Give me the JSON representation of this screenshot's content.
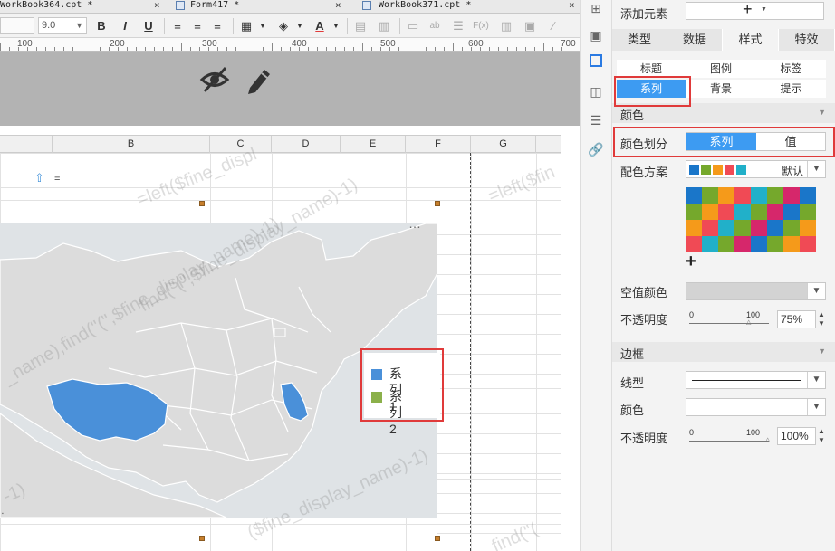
{
  "tabs": [
    {
      "label": "WorkBook364.cpt *"
    },
    {
      "label": "Form417 *"
    },
    {
      "label": "WorkBook371.cpt *"
    }
  ],
  "toolbar": {
    "font_size": "9.0",
    "bold": "B",
    "italic": "I",
    "underline": "U",
    "font_color_letter": "A"
  },
  "ruler": {
    "marks": [
      "100",
      "200",
      "300",
      "400",
      "500",
      "600",
      "700"
    ]
  },
  "sheet": {
    "columns": [
      "B",
      "C",
      "D",
      "E",
      "F",
      "G"
    ],
    "cell_formula": "=",
    "watermark_fragments": [
      "=left($fine_displ",
      "=left($fin",
      "_name),find(\"(\",$fine_display_name)-1)",
      "($fine_display_name)-1)",
      "-1)",
      "find(\"(\",$fine_display_name)-1)",
      "find(\"("
    ]
  },
  "legend": {
    "items": [
      {
        "label": "系列1",
        "color": "#4a90d9"
      },
      {
        "label": "系列2",
        "color": "#8bb04a"
      }
    ]
  },
  "map": {
    "colors": {
      "base": "#dcdcdc",
      "sea": "#dfe3e6",
      "highlight": "#4a90d9",
      "border": "#ffffff"
    }
  },
  "panel": {
    "add_element_label": "添加元素",
    "add_symbol": "+",
    "tabs": [
      {
        "label": "类型",
        "active": false
      },
      {
        "label": "数据",
        "active": false
      },
      {
        "label": "样式",
        "active": true
      },
      {
        "label": "特效",
        "active": false
      }
    ],
    "subtabs": [
      {
        "label": "标题",
        "active": false
      },
      {
        "label": "图例",
        "active": false
      },
      {
        "label": "标签",
        "active": false
      },
      {
        "label": "系列",
        "active": true
      },
      {
        "label": "背景",
        "active": false
      },
      {
        "label": "提示",
        "active": false
      }
    ],
    "color_section": "颜色",
    "color_division_label": "颜色划分",
    "color_division_options": [
      {
        "label": "系列",
        "active": true
      },
      {
        "label": "值",
        "active": false
      }
    ],
    "scheme_label": "配色方案",
    "scheme_value": "默认",
    "scheme_swatch_colors": [
      "#1a76c9",
      "#75a82c",
      "#f59a1a",
      "#f04a55",
      "#21b0c9"
    ],
    "palette_grid": [
      [
        "#1a76c9",
        "#75a82c",
        "#f59a1a",
        "#f04a55",
        "#21b0c9",
        "#75a82c",
        "#d6276b",
        "#1a76c9"
      ],
      [
        "#75a82c",
        "#f59a1a",
        "#f04a55",
        "#21b0c9",
        "#75a82c",
        "#d6276b",
        "#1a76c9",
        "#75a82c"
      ],
      [
        "#f59a1a",
        "#f04a55",
        "#21b0c9",
        "#75a82c",
        "#d6276b",
        "#1a76c9",
        "#75a82c",
        "#f59a1a"
      ],
      [
        "#f04a55",
        "#21b0c9",
        "#75a82c",
        "#d6276b",
        "#1a76c9",
        "#75a82c",
        "#f59a1a",
        "#f04a55"
      ]
    ],
    "add_color_symbol": "+",
    "empty_color_label": "空值颜色",
    "opacity_label": "不透明度",
    "opacity_slider_min": "0",
    "opacity_slider_max": "100",
    "opacity_value": "75%",
    "opacity_fraction": 0.75,
    "border_section": "边框",
    "line_type_label": "线型",
    "border_color_label": "颜色",
    "border_opacity_label": "不透明度",
    "border_slider_min": "0",
    "border_slider_max": "100",
    "border_opacity_value": "100%",
    "border_opacity_fraction": 1.0
  }
}
